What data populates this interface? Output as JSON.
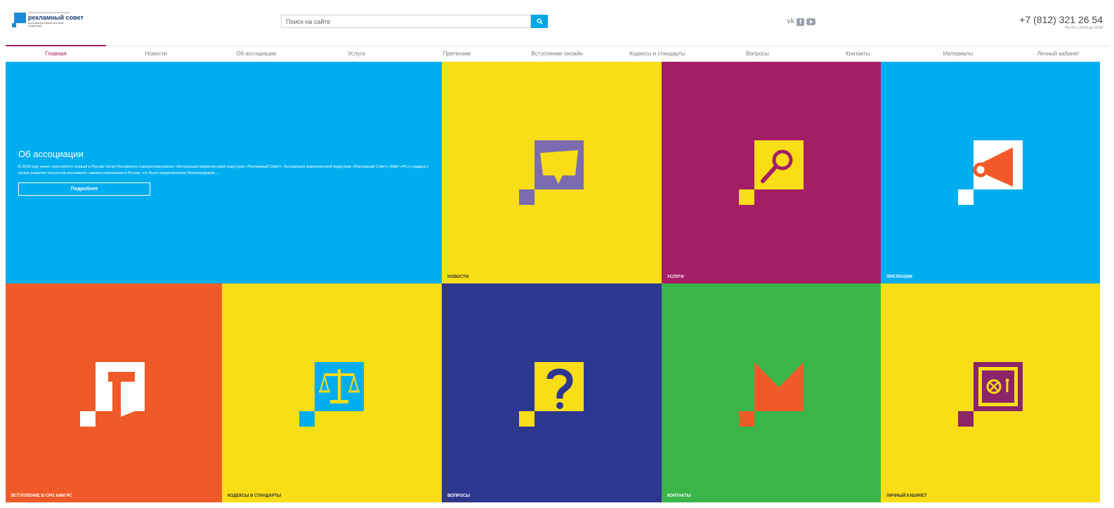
{
  "header": {
    "logo": {
      "small_text": "саморегулируемая организация",
      "title": "рекламный совет",
      "subtitle_line1": "ассоциация маркетинговой",
      "subtitle_line2": "индустрии"
    },
    "search": {
      "placeholder": "Поиск на сайте",
      "value": ""
    },
    "social": {
      "vk": "vk",
      "facebook": "f",
      "youtube": "youtube"
    },
    "phone": {
      "number": "+7 (812) 321 26 54",
      "hours": "Пн–Пт с 10:00 до 19:00"
    }
  },
  "nav": {
    "items": [
      {
        "label": "Главная",
        "active": true
      },
      {
        "label": "Новости"
      },
      {
        "label": "Об ассоциации"
      },
      {
        "label": "Услуги"
      },
      {
        "label": "Претензии"
      },
      {
        "label": "Вступление онлайн"
      },
      {
        "label": "Кодексы и стандарты"
      },
      {
        "label": "Вопросы"
      },
      {
        "label": "Контакты"
      },
      {
        "label": "Материалы"
      },
      {
        "label": "Личный кабинет"
      }
    ]
  },
  "about": {
    "title": "Об ассоциации",
    "text": "В 2018 году начал свою работу первый в России Орган Рекламного Саморегулирования «Ассоциация маркетинговой индустрии «Рекламный Совет». Ассоциация маркетинговой индустрии «Рекламный Совет» (АМИ «РС») создана с целью развития процессов рекламного саморегулирования в России, что было предусмотрено Меморандумом ...",
    "button": "Подробнее"
  },
  "tiles": {
    "news": "НОВОСТИ",
    "services": "УСЛУГИ",
    "claims": "ПРЕТЕНЗИИ",
    "join": "ВСТУПЛЕНИЕ В СРО АМИ РС",
    "codes": "КОДЕКСЫ И СТАНДАРТЫ",
    "questions": "ВОПРОСЫ",
    "contacts": "КОНТАКТЫ",
    "cabinet": "ЛИЧНЫЙ КАБИНЕТ"
  },
  "icons": {
    "search": "search-icon",
    "news": "speech-bubble-icon",
    "services": "magnifier-icon",
    "claims": "megaphone-icon",
    "join": "document-icon",
    "codes": "scales-icon",
    "questions": "question-mark-icon",
    "contacts": "envelope-icon",
    "cabinet": "safe-icon",
    "cursor": "cursor-arrow-icon"
  },
  "colors": {
    "blue": "#00aeef",
    "yellow": "#f9dd16",
    "purple": "#a41e66",
    "orange": "#f05a28",
    "navy": "#2e3790",
    "green": "#3ab54a",
    "nav_active": "#a31f5e",
    "search_button": "#00a6e6"
  }
}
